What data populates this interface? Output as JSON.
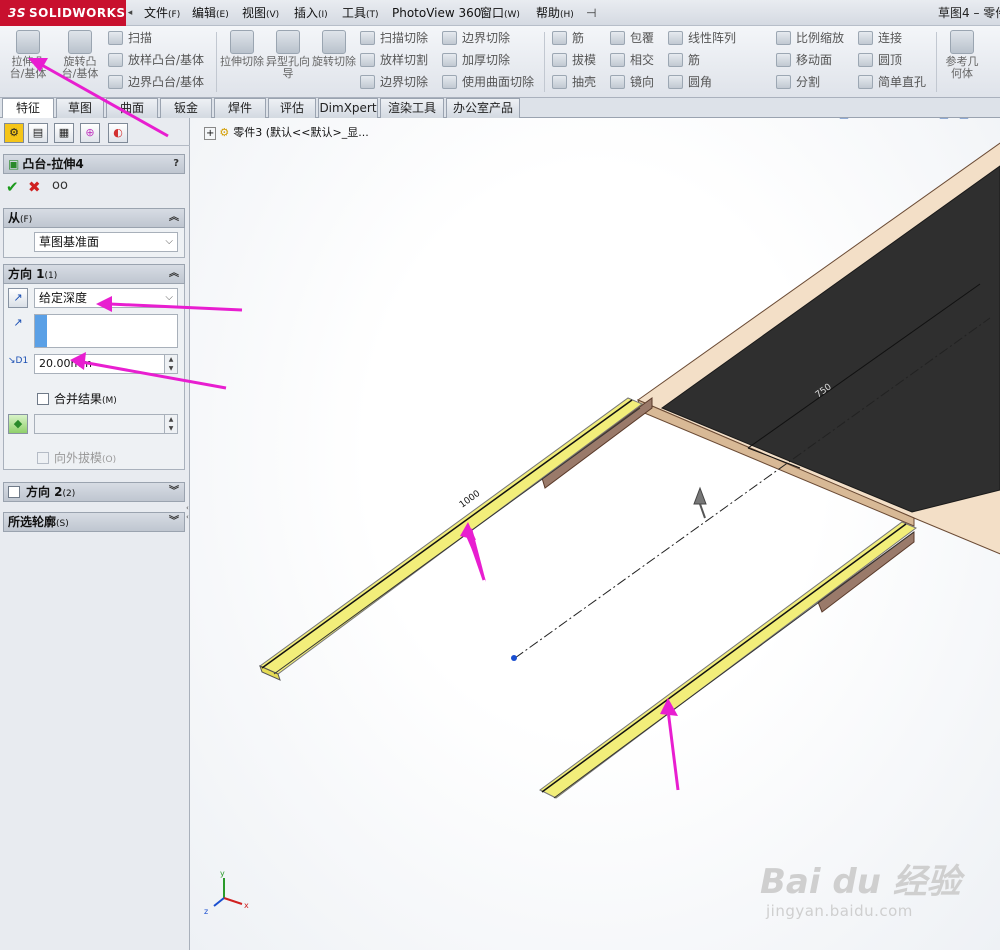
{
  "app": {
    "logo_text": "SOLIDWORKS",
    "logo_mark": "3S",
    "document_title": "草图4 – 零件3"
  },
  "menu": {
    "items": [
      {
        "label": "文件",
        "key": "(F)"
      },
      {
        "label": "编辑",
        "key": "(E)"
      },
      {
        "label": "视图",
        "key": "(V)"
      },
      {
        "label": "插入",
        "key": "(I)"
      },
      {
        "label": "工具",
        "key": "(T)"
      },
      {
        "label": "PhotoView 360",
        "key": ""
      },
      {
        "label": "窗口",
        "key": "(W)"
      },
      {
        "label": "帮助",
        "key": "(H)"
      }
    ]
  },
  "ribbon": {
    "extrude_boss": "拉伸凸台/基体",
    "revolve_boss": "旋转凸台/基体",
    "sweep": "扫描",
    "loft_boss": "放样凸台/基体",
    "boundary_boss": "边界凸台/基体",
    "extrude_cut": "拉伸切除",
    "hole_wizard": "异型孔向导",
    "revolve_cut": "旋转切除",
    "swept_cut": "扫描切除",
    "lofted_cut": "放样切割",
    "boundary_cut": "边界切除",
    "boundary_cut2": "边界切除",
    "thicken_cut": "加厚切除",
    "surface_cut": "使用曲面切除",
    "rib": "筋",
    "draft": "拔模",
    "shell": "抽壳",
    "wrap": "包覆",
    "intersect": "相交",
    "mirror": "镜向",
    "linear_pattern": "线性阵列",
    "rib2": "筋",
    "fillet": "圆角",
    "scale": "比例缩放",
    "move_face": "移动面",
    "split": "分割",
    "combine": "连接",
    "dome": "圆顶",
    "simple_hole": "简单直孔",
    "ref_geometry": "参考几何体"
  },
  "tabs": [
    "特征",
    "草图",
    "曲面",
    "钣金",
    "焊件",
    "评估",
    "DimXpert",
    "渲染工具",
    "办公室产品"
  ],
  "panel": {
    "feature_title": "凸台-拉伸4",
    "help": "?",
    "from_section": {
      "title": "从",
      "key": "(F)",
      "value": "草图基准面"
    },
    "direction1": {
      "title": "方向 1",
      "key": "(1)",
      "end_condition": "给定深度",
      "depth": "20.00mm",
      "depth_label": "D1",
      "merge_result": "合并结果",
      "merge_key": "(M)",
      "draft_outward": "向外拔模",
      "draft_key": "(O)"
    },
    "direction2": {
      "title": "方向 2",
      "key": "(2)"
    },
    "selected_contours": {
      "title": "所选轮廓",
      "key": "(S)"
    }
  },
  "viewport": {
    "tree_label": "零件3  (默认<<默认>_显...",
    "dimension_1": "1000",
    "dimension_2": "750",
    "axis_x": "x",
    "axis_y": "y",
    "axis_z": "z"
  },
  "watermark": {
    "brand": "Bai du 经验",
    "url": "jingyan.baidu.com"
  },
  "colors": {
    "accent_red": "#c8102e",
    "annotation_arrow": "#e81ed0",
    "selected_yellow": "#f2ee7a",
    "board_dark": "#2d2d2d",
    "board_frame": "#f1ddc4"
  }
}
